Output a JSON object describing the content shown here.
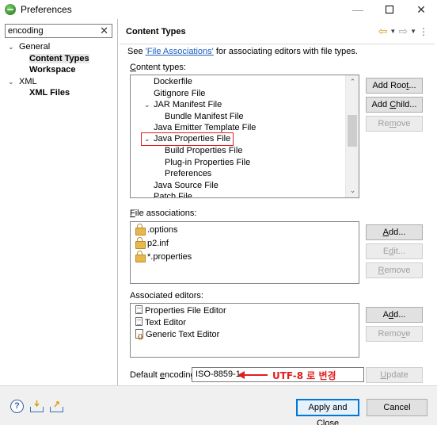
{
  "window": {
    "title": "Preferences",
    "minimize": "—",
    "close": "✕"
  },
  "left": {
    "filter_value": "encoding",
    "filter_clear": "✕",
    "tree": [
      {
        "label": "General",
        "level": 0,
        "expanded": true
      },
      {
        "label": "Content Types",
        "level": 1,
        "selected": true
      },
      {
        "label": "Workspace",
        "level": 1
      },
      {
        "label": "XML",
        "level": 0,
        "expanded": true
      },
      {
        "label": "XML Files",
        "level": 1
      }
    ]
  },
  "header": {
    "title": "Content Types"
  },
  "see": {
    "prefix": "See ",
    "link": "'File Associations'",
    "suffix": " for associating editors with file types."
  },
  "content_types": {
    "label_u": "C",
    "label_rest": "ontent types:",
    "items": [
      {
        "label": "Dockerfile",
        "level": 1
      },
      {
        "label": "Gitignore File",
        "level": 1
      },
      {
        "label": "JAR Manifest File",
        "level": 1,
        "expanded": true
      },
      {
        "label": "Bundle Manifest File",
        "level": 2
      },
      {
        "label": "Java Emitter Template File",
        "level": 1
      },
      {
        "label": "Java Properties File",
        "level": 1,
        "expanded": true,
        "selected": true
      },
      {
        "label": "Build Properties File",
        "level": 2
      },
      {
        "label": "Plug-in Properties File",
        "level": 2
      },
      {
        "label": "Preferences",
        "level": 2
      },
      {
        "label": "Java Source File",
        "level": 1
      },
      {
        "label": "Patch File",
        "level": 1
      }
    ],
    "add_root_pre": "Add Roo",
    "add_root_u": "t",
    "add_root_post": "...",
    "add_child_pre": "Add ",
    "add_child_u": "C",
    "add_child_post": "hild...",
    "remove_pre": "Re",
    "remove_u": "m",
    "remove_post": "ove"
  },
  "file_associations": {
    "label_u": "F",
    "label_rest": "ile associations:",
    "items": [
      ".options",
      "p2.inf",
      "*.properties"
    ],
    "add_u": "A",
    "add_rest": "dd...",
    "edit_pre": "E",
    "edit_u": "d",
    "edit_post": "it...",
    "remove_u": "R",
    "remove_rest": "emove"
  },
  "associated_editors": {
    "label": "Associated editors:",
    "items": [
      "Properties File Editor",
      "Text Editor",
      "Generic Text Editor"
    ],
    "add_pre": "A",
    "add_u": "d",
    "add_post": "d...",
    "remove_pre": "Remo",
    "remove_u": "v",
    "remove_post": "e"
  },
  "encoding": {
    "label_pre": "Default ",
    "label_u": "e",
    "label_post": "ncoding:",
    "value": "ISO-8859-1",
    "annotation": "UTF-8 로 변경",
    "update_u": "U",
    "update_rest": "pdate"
  },
  "bottom": {
    "help": "?",
    "apply_close": "Apply and Close",
    "cancel": "Cancel"
  },
  "colors": {
    "accent_red": "#e02020",
    "link_blue": "#1a5dbf",
    "focus_blue": "#0078d7"
  }
}
